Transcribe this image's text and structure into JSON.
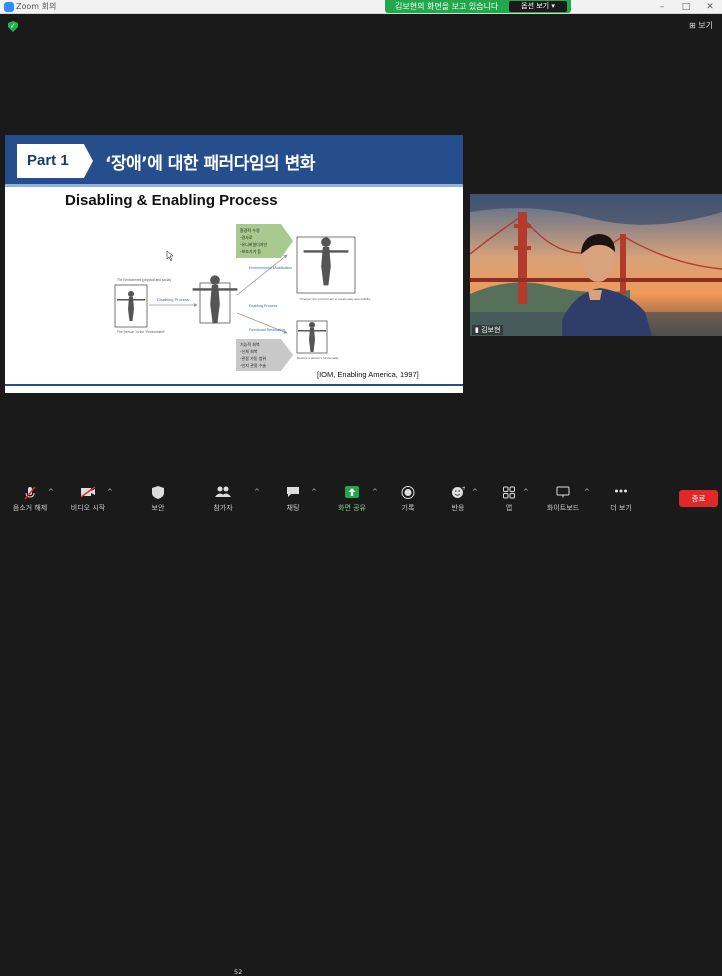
{
  "window": {
    "title": "Zoom 회의"
  },
  "share_banner": {
    "text": "김보현의 화면을 보고 있습니다",
    "options_label": "옵션 보기"
  },
  "view_button": {
    "label": "보기"
  },
  "slide": {
    "part": "Part 1",
    "headline": "‘장애’에 대한 패러다임의 변화",
    "subtitle": "Disabling & Enabling Process",
    "citation": "[IOM, Enabling America, 1997]",
    "diagram": {
      "env_mod_box": [
        "환경적 수정",
        "-경사로",
        "-유니버설디자인",
        "-보조기기 등"
      ],
      "func_restore_box": [
        "기능적 회복",
        "-신체 회복",
        "-관절 가동 범위",
        "-인지 관절 수술"
      ],
      "disabling_process": "Disabling Process",
      "env_modification": "Environmental Modification",
      "enabling_process": "Enabling Process",
      "functional_restoration": "Functional Restoration",
      "env_caption": "The Environment (physical and social)",
      "person_caption": "The \"person\" in the \"Environment\"",
      "right_top_caption": "\"Change\" the environment to create easy accessibility",
      "right_bottom_caption": "Restore a person's functionality"
    }
  },
  "video": {
    "participant_name": "김보현"
  },
  "toolbar": {
    "mute": "음소거 해제",
    "video": "비디오 시작",
    "security": "보안",
    "participants": "참가자",
    "participants_count": "52",
    "chat": "채팅",
    "share": "화면 공유",
    "record": "기록",
    "reactions": "반응",
    "apps": "앱",
    "whiteboard": "화이트보드",
    "more": "더 보기",
    "end": "종료"
  },
  "colors": {
    "share_green": "#21a84a",
    "end_red": "#e02828",
    "slide_blue": "#264d8c"
  }
}
